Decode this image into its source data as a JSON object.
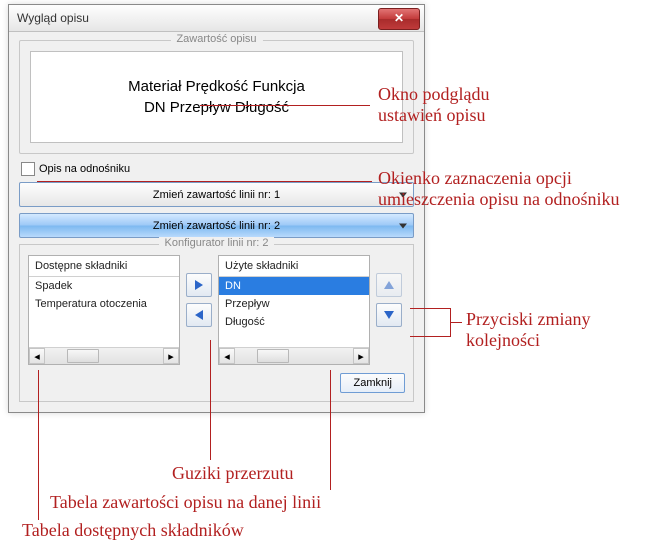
{
  "window": {
    "title": "Wygląd opisu",
    "close": "✕"
  },
  "content_group": {
    "legend": "Zawartość opisu",
    "preview_line1": "Materiał Prędkość Funkcja",
    "preview_line2": "DN Przepływ Długość"
  },
  "checkbox_label": "Opis na odnośniku",
  "combo1": "Zmień zawartość linii nr: 1",
  "combo2": "Zmień zawartość linii nr: 2",
  "config": {
    "legend": "Konfigurator linii nr: 2",
    "available_header": "Dostępne składniki",
    "available_items": [
      "Spadek",
      "Temperatura otoczenia"
    ],
    "used_header": "Użyte składniki",
    "used_items": [
      "DN",
      "Przepływ",
      "Długość"
    ]
  },
  "close_button": "Zamknij",
  "annotations": {
    "a1a": "Okno podglądu",
    "a1b": "ustawień opisu",
    "a2a": "Okienko zaznaczenia opcji",
    "a2b": "umieszczenia opisu na odnośniku",
    "a3a": "Przyciski zmiany",
    "a3b": "kolejności",
    "a4": "Guziki przerzutu",
    "a5": "Tabela zawartości opisu na danej linii",
    "a6": "Tabela dostępnych składników"
  }
}
